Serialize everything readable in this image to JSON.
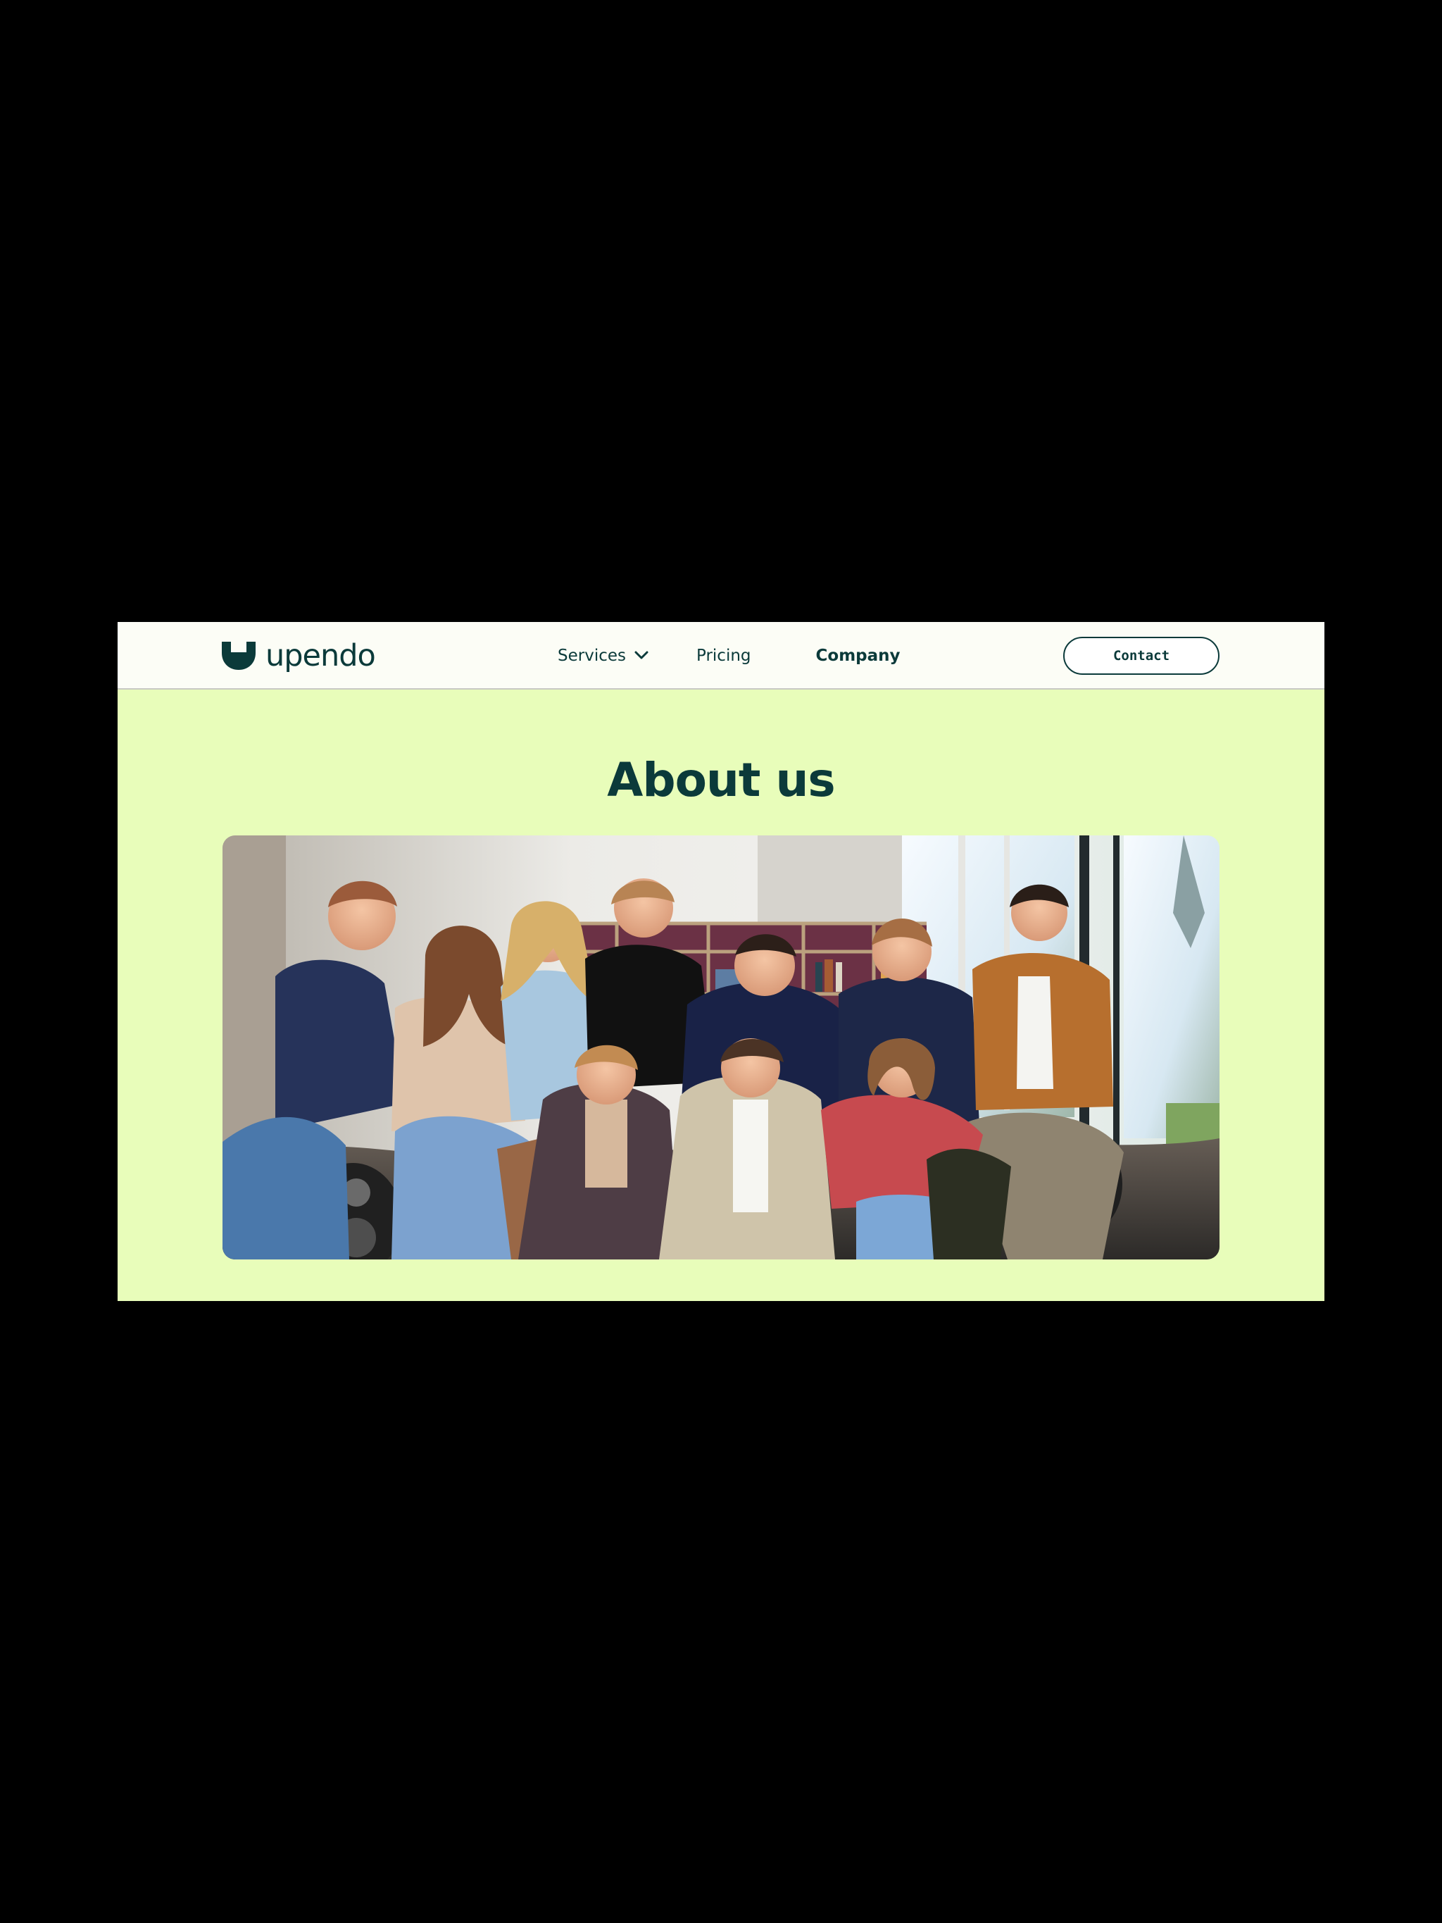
{
  "brand": {
    "name": "upendo",
    "logo_icon": "upendo-u-mark-icon",
    "color": "#0b3a3a"
  },
  "nav": {
    "items": [
      {
        "label": "Services",
        "has_dropdown": true,
        "icon": "chevron-down-icon"
      },
      {
        "label": "Pricing"
      },
      {
        "label": "Company",
        "active": true
      }
    ],
    "contact_label": "Contact"
  },
  "main": {
    "title": "About us",
    "background": "#e8fdba",
    "photo": {
      "subject": "team-group-photo"
    }
  }
}
